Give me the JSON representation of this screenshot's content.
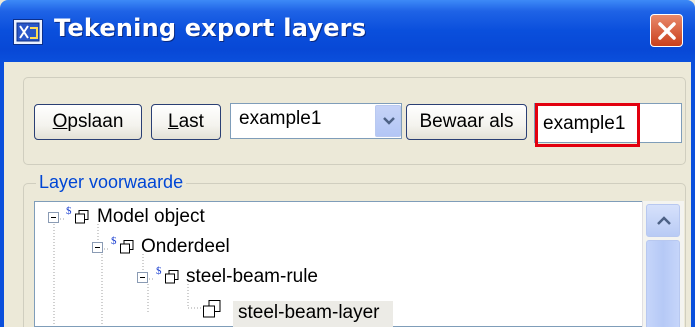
{
  "window": {
    "title": "Tekening export layers",
    "icon": "drawing-export-icon",
    "close_icon": "close-icon"
  },
  "toolbar": {
    "save_label": "Opslaan",
    "save_mnemonic": "O",
    "load_label": "Last",
    "load_mnemonic": "L",
    "preset_value": "example1",
    "save_as_label": "Bewaar als",
    "save_as_name": "example1"
  },
  "layer_group": {
    "label": "Layer voorwaarde",
    "tree": [
      {
        "label": "Model object",
        "marker": "$"
      },
      {
        "label": "Onderdeel",
        "marker": "$"
      },
      {
        "label": "steel-beam-rule",
        "marker": "$"
      },
      {
        "label": "steel-beam-layer",
        "marker": ""
      }
    ]
  },
  "colors": {
    "titlebar": "#0a4fdc",
    "highlight": "#e2000f",
    "group_label": "#0046d5"
  }
}
